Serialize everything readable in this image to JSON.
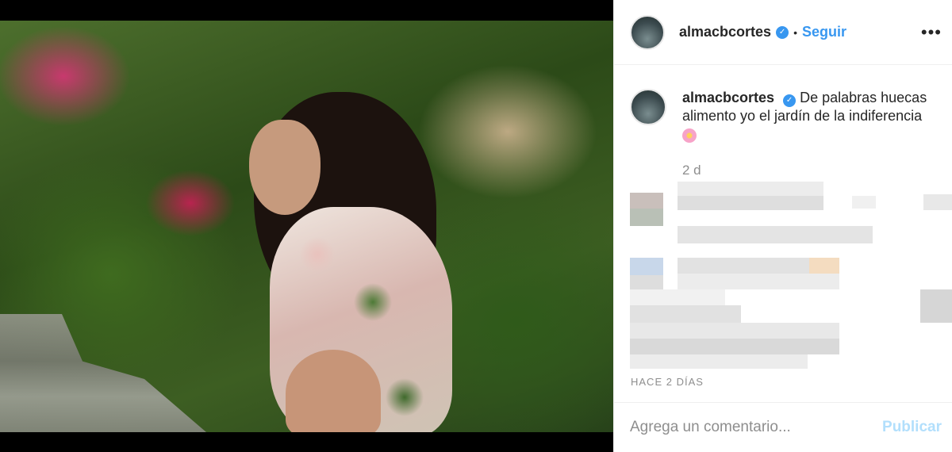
{
  "post": {
    "author": {
      "username": "almacbcortes",
      "verified_icon": "verified-badge-icon"
    },
    "follow_label": "Seguir",
    "more_icon": "more-options-icon",
    "separator": "•",
    "caption": {
      "username": "almacbcortes",
      "text": "De palabras huecas alimento yo el jardín de la indiferencia",
      "emoji_icon": "flower-emoji-icon"
    },
    "caption_age": "2 d",
    "timestamp": "HACE 2 DÍAS",
    "comment": {
      "placeholder": "Agrega un comentario...",
      "value": "",
      "publish_label": "Publicar"
    }
  },
  "colors": {
    "link_blue": "#3897f0",
    "publish_disabled": "#b2dffc",
    "muted_text": "#8e8e8e",
    "divider": "#efefef"
  }
}
